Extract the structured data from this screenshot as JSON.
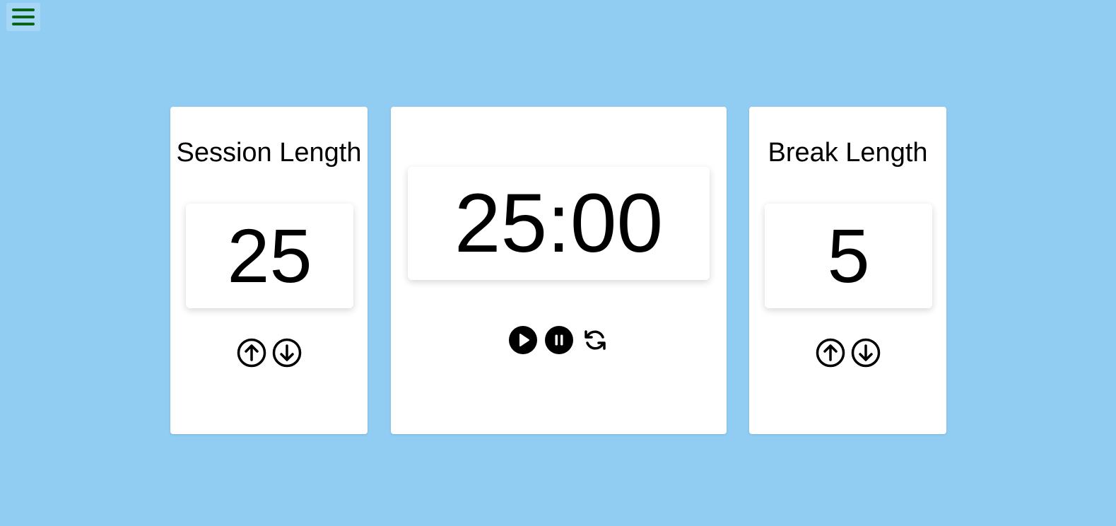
{
  "menu": {
    "icon": "hamburger-menu-icon",
    "color": "#0b6317"
  },
  "session": {
    "title": "Session Length",
    "value": "25",
    "increment_icon": "arrow-up-circle-icon",
    "decrement_icon": "arrow-down-circle-icon"
  },
  "timer": {
    "display": "25:00",
    "play_icon": "play-circle-icon",
    "pause_icon": "pause-circle-icon",
    "reset_icon": "refresh-icon"
  },
  "break": {
    "title": "Break Length",
    "value": "5",
    "increment_icon": "arrow-up-circle-icon",
    "decrement_icon": "arrow-down-circle-icon"
  },
  "colors": {
    "background": "#91cdf3",
    "card": "#ffffff",
    "menu_icon": "#0b6317"
  }
}
